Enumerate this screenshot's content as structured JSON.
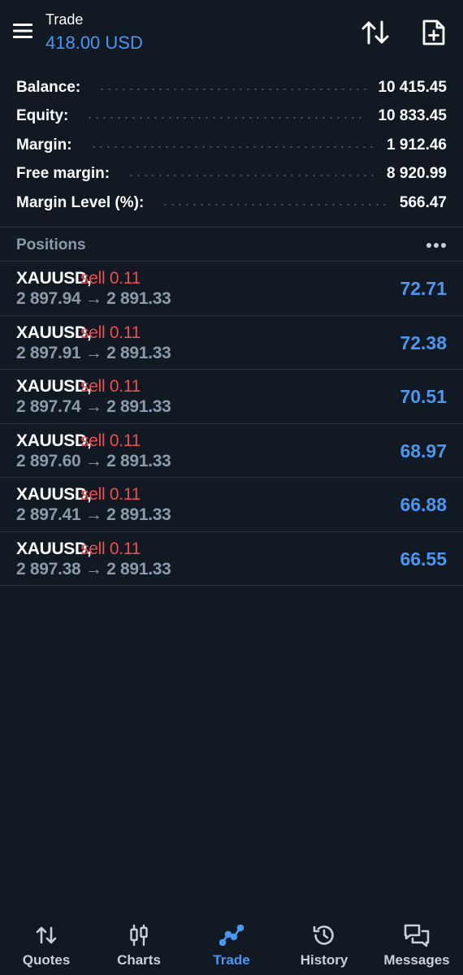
{
  "header": {
    "title": "Trade",
    "subtitle": "418.00 USD",
    "icons": {
      "menu": "hamburger-menu-icon",
      "sort": "sort-arrows-icon",
      "new_order": "new-document-plus-icon"
    }
  },
  "summary": [
    {
      "label": "Balance:",
      "value": "10 415.45"
    },
    {
      "label": "Equity:",
      "value": "10 833.45"
    },
    {
      "label": "Margin:",
      "value": "1 912.46"
    },
    {
      "label": "Free margin:",
      "value": "8 920.99"
    },
    {
      "label": "Margin Level (%):",
      "value": "566.47"
    }
  ],
  "positions": {
    "title": "Positions",
    "more_icon": "more-dots-icon",
    "items": [
      {
        "symbol": "XAUUSD",
        "side": "sell 0.11",
        "open": "2 897.94",
        "current": "2 891.33",
        "profit": "72.71"
      },
      {
        "symbol": "XAUUSD",
        "side": "sell 0.11",
        "open": "2 897.91",
        "current": "2 891.33",
        "profit": "72.38"
      },
      {
        "symbol": "XAUUSD",
        "side": "sell 0.11",
        "open": "2 897.74",
        "current": "2 891.33",
        "profit": "70.51"
      },
      {
        "symbol": "XAUUSD",
        "side": "sell 0.11",
        "open": "2 897.60",
        "current": "2 891.33",
        "profit": "68.97"
      },
      {
        "symbol": "XAUUSD",
        "side": "sell 0.11",
        "open": "2 897.41",
        "current": "2 891.33",
        "profit": "66.88"
      },
      {
        "symbol": "XAUUSD",
        "side": "sell 0.11",
        "open": "2 897.38",
        "current": "2 891.33",
        "profit": "66.55"
      }
    ]
  },
  "nav": {
    "active": "Trade",
    "items": [
      {
        "label": "Quotes",
        "icon": "quotes-arrows-icon"
      },
      {
        "label": "Charts",
        "icon": "candlestick-chart-icon"
      },
      {
        "label": "Trade",
        "icon": "trade-line-icon"
      },
      {
        "label": "History",
        "icon": "history-clock-icon"
      },
      {
        "label": "Messages",
        "icon": "messages-chat-icon"
      }
    ]
  },
  "colors": {
    "background": "#111923",
    "accent": "#4a97f0",
    "sell": "#ee4d4d",
    "muted": "#8b99aa",
    "divider": "#2a3440"
  }
}
